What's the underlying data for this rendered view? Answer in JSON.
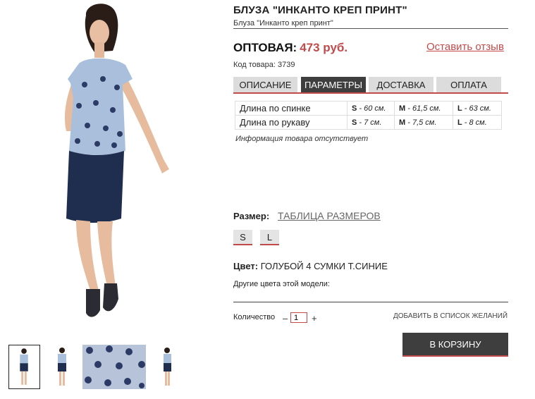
{
  "product": {
    "title": "БЛУЗА \"ИНКАНТО КРЕП ПРИНТ\"",
    "subtitle": "Блуза \"Инканто креп принт\"",
    "price_label": "ОПТОВАЯ:",
    "price_value": "473 руб.",
    "review_link": "Оставить отзыв",
    "sku": "Код товара: 3739"
  },
  "tabs": [
    "ОПИСАНИЕ",
    "ПАРАМЕТРЫ",
    "ДОСТАВКА",
    "ОПЛАТА"
  ],
  "active_tab": "ПАРАМЕТРЫ",
  "params": {
    "rows": [
      {
        "name": "Длина по спинке",
        "s": "S",
        "s_val": " - 60 см.",
        "m": "M",
        "m_val": " - 61,5 см.",
        "l": "L",
        "l_val": " - 63 см."
      },
      {
        "name": "Длина по рукаву",
        "s": "S",
        "s_val": " - 7 см.",
        "m": "M",
        "m_val": " - 7,5 см.",
        "l": "L",
        "l_val": " - 8 см."
      }
    ],
    "info_missing": "Информация товара отсутствует"
  },
  "size": {
    "label": "Размер:",
    "chart_link": "ТАБЛИЦА РАЗМЕРОВ",
    "options": [
      "S",
      "L"
    ]
  },
  "color": {
    "label": "Цвет:",
    "value": "ГОЛУБОЙ 4 СУМКИ Т.СИНИЕ",
    "other_colors": "Другие цвета этой модели:"
  },
  "quantity": {
    "label": "Количество",
    "minus": "–",
    "value": "1",
    "plus": "+"
  },
  "wishlist": "ДОБАВИТЬ В СПИСОК ЖЕЛАНИЙ",
  "cart_button": "В КОРЗИНУ",
  "colors": {
    "accent": "#c24a4a",
    "dark_button": "#3e3e3e",
    "tab_inactive": "#dcdcdc",
    "blouse_blue": "#a9bfdc",
    "skirt_navy": "#1f2d4f"
  }
}
